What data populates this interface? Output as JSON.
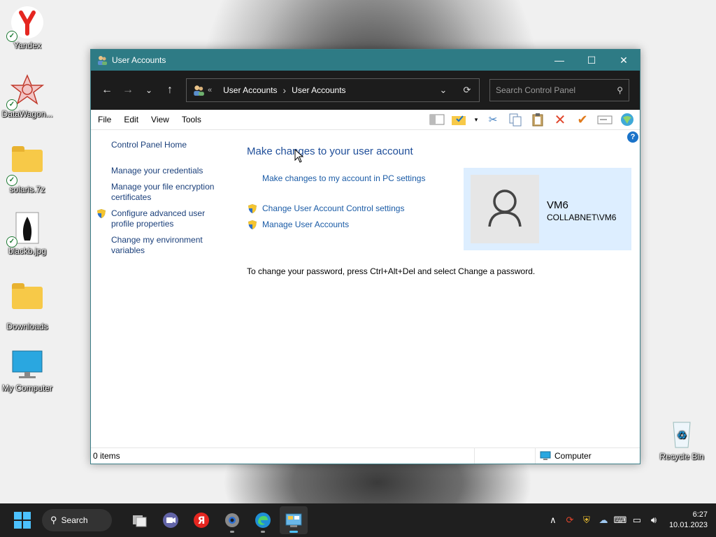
{
  "desktop": {
    "icons": [
      {
        "label": "Yandex"
      },
      {
        "label": "DataWagon..."
      },
      {
        "label": "solaris.7z"
      },
      {
        "label": "blackb.jpg"
      },
      {
        "label": "Downloads"
      },
      {
        "label": "My Computer"
      },
      {
        "label": "Recycle Bin"
      }
    ]
  },
  "window": {
    "title": "User Accounts",
    "address": {
      "chevron": "«",
      "crumbs": [
        "User Accounts",
        "User Accounts"
      ],
      "separator": "›"
    },
    "search_placeholder": "Search Control Panel",
    "menu": [
      "File",
      "Edit",
      "View",
      "Tools"
    ],
    "left_nav": {
      "home": "Control Panel Home",
      "items": [
        "Manage your credentials",
        "Manage your file encryption certificates",
        "Configure advanced user profile properties",
        "Change my environment variables"
      ]
    },
    "main": {
      "title": "Make changes to your user account",
      "pc_settings_link": "Make changes to my account in PC settings",
      "uac_link": "Change User Account Control settings",
      "manage_link": "Manage User Accounts",
      "password_note": "To change your password, press Ctrl+Alt+Del and select Change a password."
    },
    "user": {
      "name": "VM6",
      "domain": "COLLABNET\\VM6"
    },
    "status": {
      "items": "0 items",
      "location": "Computer"
    }
  },
  "taskbar": {
    "search_label": "Search",
    "time": "6:27",
    "date": "10.01.2023"
  },
  "colors": {
    "titlebar": "#2e7b85",
    "addressbar": "#1c1c1c",
    "link": "#1a5ba6",
    "usercard": "#ddeeff",
    "taskbar": "#1f1f1f"
  }
}
